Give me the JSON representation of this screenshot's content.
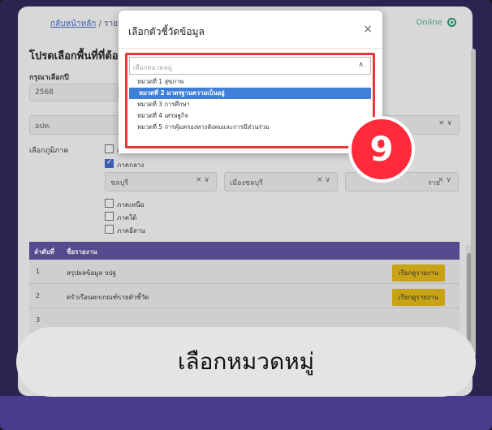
{
  "header": {
    "breadcrumb_link": "กลับหน้าหลัก",
    "breadcrumb_sep": "/",
    "breadcrumb_current": "รายงาน",
    "status": "Online"
  },
  "form": {
    "title": "โปรดเลือกพื้นที่ที่ต้อง",
    "year_label": "กรุณาเลือกปี",
    "year_value": "2568",
    "org_value": "อปท.",
    "region_label": "เลือกภูมิภาค",
    "regions": [
      {
        "label": "เลือ",
        "checked": false
      },
      {
        "label": "ภาคกลาง",
        "checked": true
      },
      {
        "label": "ภาคเหนือ",
        "checked": false
      },
      {
        "label": "ภาคใต้",
        "checked": false
      },
      {
        "label": "ภาคอีสาน",
        "checked": false
      }
    ],
    "province_value": "ชลบุรี",
    "district_value": "เมืองชลบุรี",
    "subdistrict_value": "ราย"
  },
  "table": {
    "headers": [
      "ลำดับที่",
      "ชื่อรายงาน"
    ],
    "rows": [
      {
        "no": "1",
        "name": "สรุปผลข้อมูล จปฐ",
        "action": "เรียกดูรายงาน"
      },
      {
        "no": "2",
        "name": "ครัวเรือนตกเกณฑ์รายตัวชี้วัด",
        "action": "เรียกดูรายงาน"
      },
      {
        "no": "3",
        "name": "",
        "action": ""
      }
    ]
  },
  "modal": {
    "title": "เลือกตัวชี้วัดข้อมูล",
    "close": "×",
    "placeholder": "เลือกหมวดหมู่",
    "options": [
      "หมวดที่ 1 สุขภาพ",
      "หมวดที่ 2 มาตรฐานความเป็นอยู่",
      "หมวดที่ 3 การศึกษา",
      "หมวดที่ 4 เศรษฐกิจ",
      "หมวดที่ 5 การคุ้มครองทางสังคมและการมีส่วนร่วม"
    ],
    "selected_index": 1
  },
  "step_badge": "9",
  "caption": "เลือกหมวดหมู่",
  "colors": {
    "highlight_border": "#e53935",
    "selected_option": "#3f7fd8",
    "badge": "#ff2a3a",
    "table_header": "#544a8e",
    "action_button": "#c8a316"
  }
}
